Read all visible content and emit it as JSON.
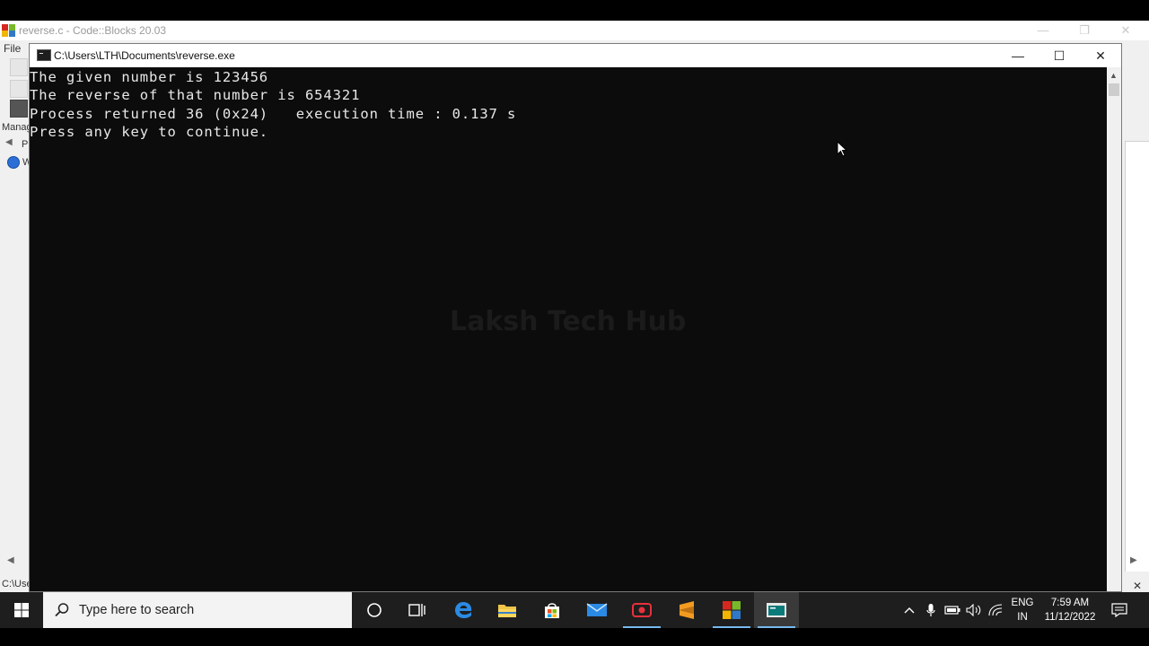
{
  "codeblocks": {
    "title": "reverse.c - Code::Blocks 20.03",
    "menu_file": "File",
    "panel_tab": "Management",
    "tree_projects_label": "Projects",
    "tree_workspace_label": "Workspace",
    "status_text": "C:\\Users\\LTH\\Documents\\reverse.c"
  },
  "console": {
    "title": "C:\\Users\\LTH\\Documents\\reverse.exe",
    "lines": [
      "The given number is 123456",
      "The reverse of that number is 654321",
      "Process returned 36 (0x24)   execution time : 0.137 s",
      "Press any key to continue."
    ],
    "watermark": "Laksh Tech Hub"
  },
  "taskbar": {
    "search_placeholder": "Type here to search",
    "apps": [
      "cortana-icon",
      "task-view-icon",
      "edge-icon",
      "file-explorer-icon",
      "store-icon",
      "mail-icon",
      "screen-recorder-icon",
      "sublime-text-icon",
      "codeblocks-icon",
      "console-icon"
    ],
    "lang_line1": "ENG",
    "lang_line2": "IN",
    "time": "7:59 AM",
    "date": "11/12/2022"
  },
  "colors": {
    "console_bg": "#0c0c0c",
    "console_text": "#e8e8e8",
    "taskbar_bg": "#1e1e1e",
    "accent": "#76b9ed"
  }
}
